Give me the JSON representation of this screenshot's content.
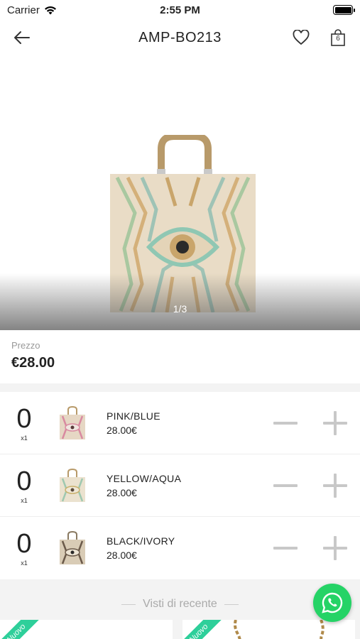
{
  "status_bar": {
    "carrier": "Carrier",
    "time": "2:55 PM"
  },
  "nav": {
    "title": "AMP-BO213",
    "cart_count": "6"
  },
  "gallery": {
    "indicator": "1/3"
  },
  "price": {
    "label": "Prezzo",
    "value": "€28.00"
  },
  "variants": [
    {
      "qty": "0",
      "mult": "x1",
      "name": "PINK/BLUE",
      "price": "28.00€",
      "accent": "#d98aa0"
    },
    {
      "qty": "0",
      "mult": "x1",
      "name": "YELLOW/AQUA",
      "price": "28.00€",
      "accent": "#9fc8b0"
    },
    {
      "qty": "0",
      "mult": "x1",
      "name": "BLACK/IVORY",
      "price": "28.00€",
      "accent": "#6b5a4a"
    }
  ],
  "recent": {
    "title": "Visti di recente",
    "badge": "Nuovo"
  },
  "colors": {
    "whatsapp": "#25d366",
    "ribbon": "#2ecf9a"
  }
}
